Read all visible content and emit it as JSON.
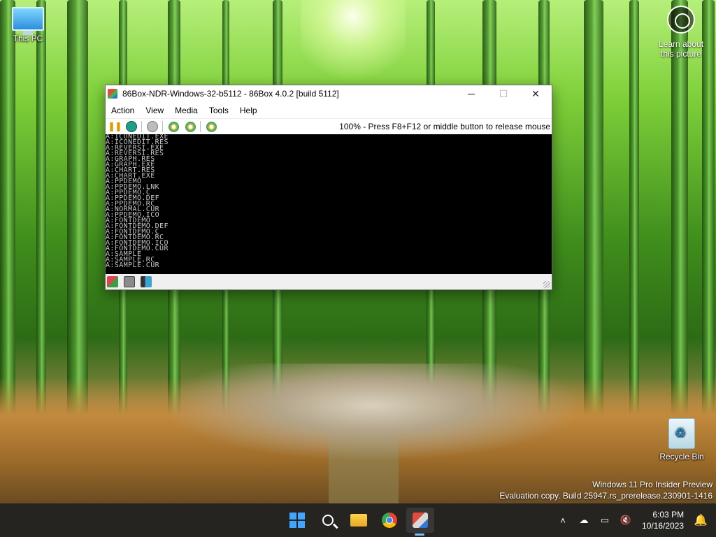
{
  "desktop": {
    "icons": {
      "this_pc": "This PC",
      "recycle_bin": "Recycle Bin"
    },
    "learn_picture": {
      "line1": "Learn about",
      "line2": "this picture"
    },
    "watermark": {
      "line1": "Windows 11 Pro Insider Preview",
      "line2": "Evaluation copy. Build 25947.rs_prerelease.230901-1416"
    }
  },
  "window": {
    "title": "86Box-NDR-Windows-32-b5112 - 86Box 4.0.2 [build 5112]",
    "controls": {
      "minimize": "─",
      "maximize": "☐",
      "close": "✕"
    },
    "menu": [
      "Action",
      "View",
      "Media",
      "Tools",
      "Help"
    ],
    "toolbar": {
      "status_text": "100% - Press F8+F12 or middle button to release mouse"
    },
    "screen_lines": [
      "A:ICONEDIT.EXE",
      "A:ICONEDIT.RES",
      "A:REVERSI.EXE",
      "A:REVERSI.RES",
      "A:GRAPH.RES",
      "A:GRAPH.EXE",
      "A:CHART.RES",
      "A:CHART.EXE",
      "A:PPDEMO",
      "A:PPDEMO.LNK",
      "A:PPDEMO.C",
      "A:PPDEMO.DEF",
      "A:PPDEMO.RC",
      "A:NORMAL.CUR",
      "A:PPDEMO.ICO",
      "A:FONTDEMO",
      "A:FONTDEMO.DEF",
      "A:FONTDEMO.C",
      "A:FONTDEMO.RC",
      "A:FONTDEMO.ICO",
      "A:FONTDEMO.CUR",
      "A:SAMPLE",
      "A:SAMPLE.RC",
      "A:SAMPLE.CUR"
    ]
  },
  "taskbar": {
    "clock": {
      "time": "6:03 PM",
      "date": "10/16/2023"
    }
  }
}
